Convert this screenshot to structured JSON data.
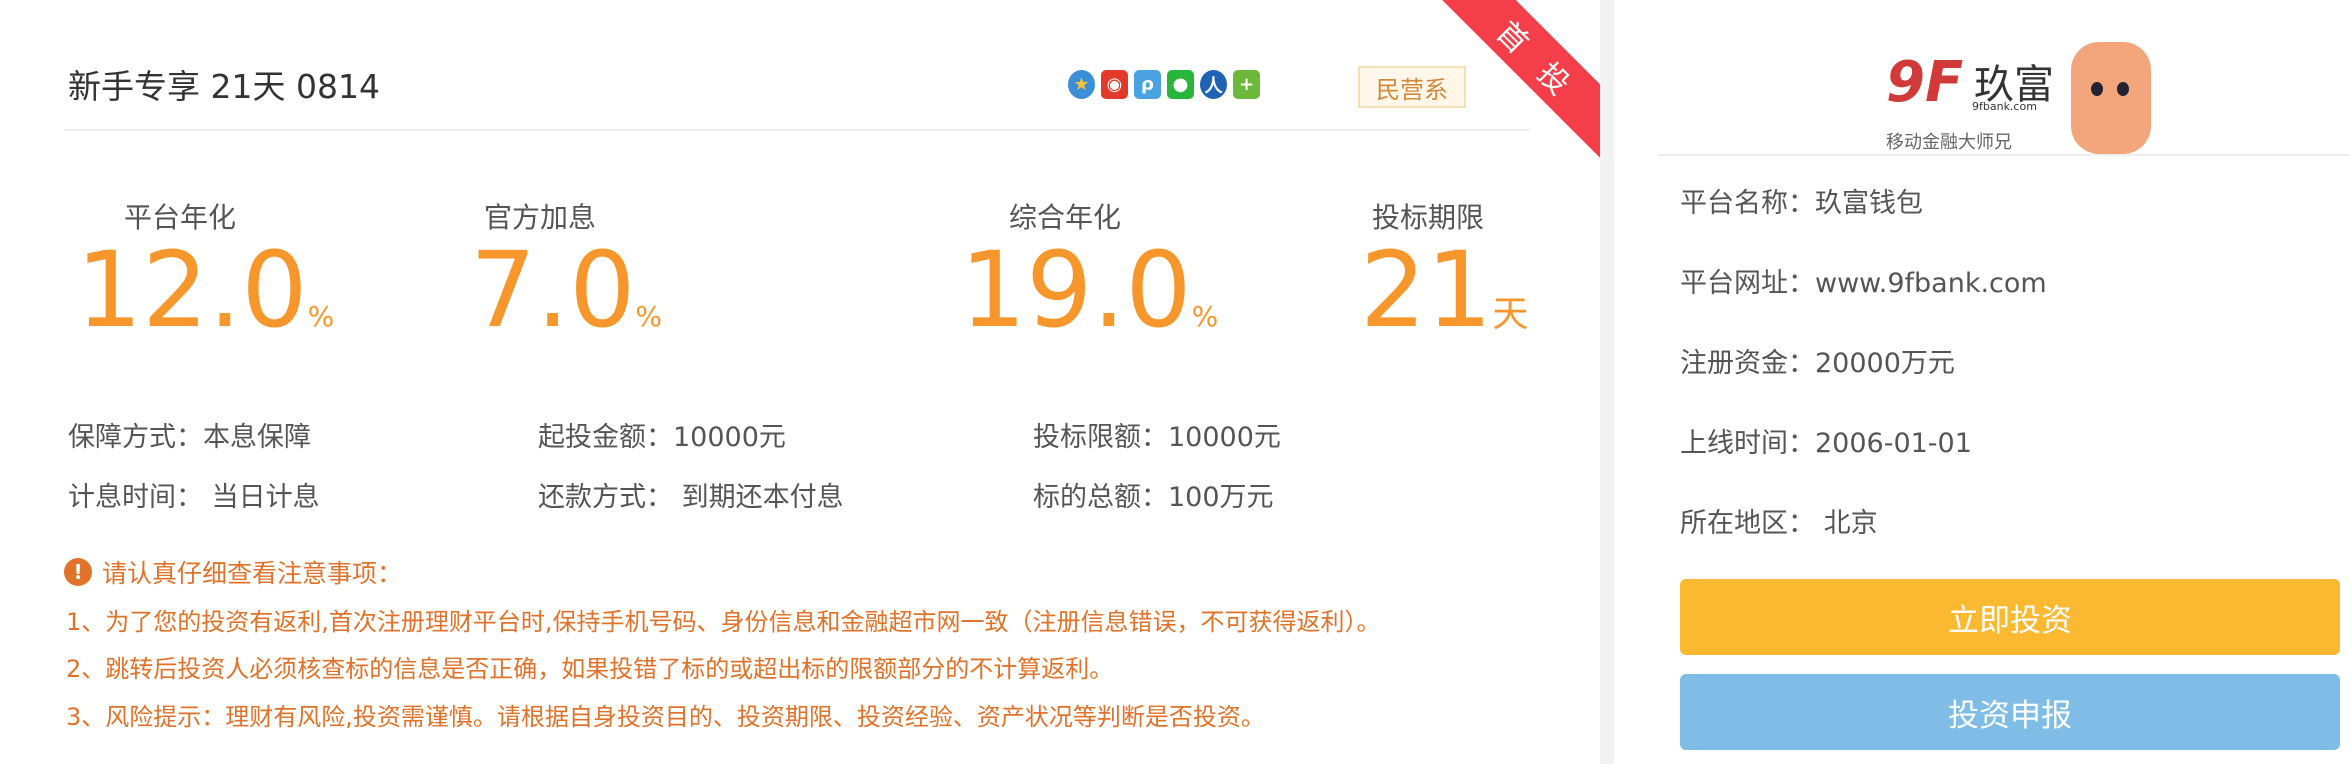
{
  "product": {
    "title": "新手专享 21天 0814",
    "tag": "民营系",
    "ribbon": "首投",
    "share_icons": [
      "qzone-icon",
      "weibo-icon",
      "tencent-weibo-icon",
      "wechat-icon",
      "renren-icon",
      "more-share-icon"
    ]
  },
  "rates": [
    {
      "label": "平台年化",
      "value": "12.0",
      "unit": "%"
    },
    {
      "label": "官方加息",
      "value": "7.0",
      "unit": "%"
    },
    {
      "label": "综合年化",
      "value": "19.0",
      "unit": "%"
    },
    {
      "label": "投标期限",
      "value": "21",
      "unit": "天"
    }
  ],
  "info": [
    [
      "保障方式：本息保障",
      "起投金额：10000元",
      "投标限额：10000元"
    ],
    [
      "计息时间： 当日计息",
      "还款方式： 到期还本付息",
      "标的总额：100万元"
    ]
  ],
  "notice": {
    "heading": "请认真仔细查看注意事项：",
    "items": [
      "1、为了您的投资有返利,首次注册理财平台时,保持手机号码、身份信息和金融超市网一致（注册信息错误，不可获得返利）。",
      "2、跳转后投资人必须核查标的信息是否正确，如果投错了标的或超出标的限额部分的不计算返利。",
      "3、风险提示：理财有风险,投资需谨慎。请根据自身投资目的、投资期限、投资经验、资产状况等判断是否投资。"
    ]
  },
  "platform": {
    "logo_text": "9F 玖富 9fbank.com 移动金融大师兄",
    "rows": [
      "平台名称：玖富钱包",
      "平台网址：www.9fbank.com",
      "注册资金：20000万元",
      "上线时间：2006-01-01",
      "所在地区： 北京"
    ],
    "invest_button": "立即投资",
    "report_button": "投资申报",
    "colors": {
      "invest": "#fbb932",
      "report": "#7fbde6",
      "accent": "#f7962a",
      "notice": "#e0722a"
    }
  }
}
